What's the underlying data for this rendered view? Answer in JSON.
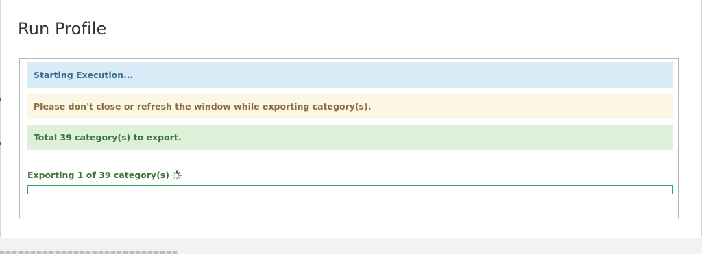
{
  "dialog": {
    "title": "Run Profile"
  },
  "messages": {
    "info": "Starting Execution...",
    "warning": "Please don't close or refresh the window while exporting category(s).",
    "success": "Total 39 category(s) to export."
  },
  "progress": {
    "label": "Exporting 1 of 39 category(s)",
    "value": 0,
    "icon": "loading-spinner-icon"
  },
  "colors": {
    "info_bg": "#d9ebf6",
    "info_text": "#31708f",
    "warning_bg": "#fcf6e4",
    "warning_text": "#8a6d3b",
    "success_bg": "#dff0d8",
    "success_text": "#3c763d",
    "progress_border": "#2eaa5c"
  }
}
